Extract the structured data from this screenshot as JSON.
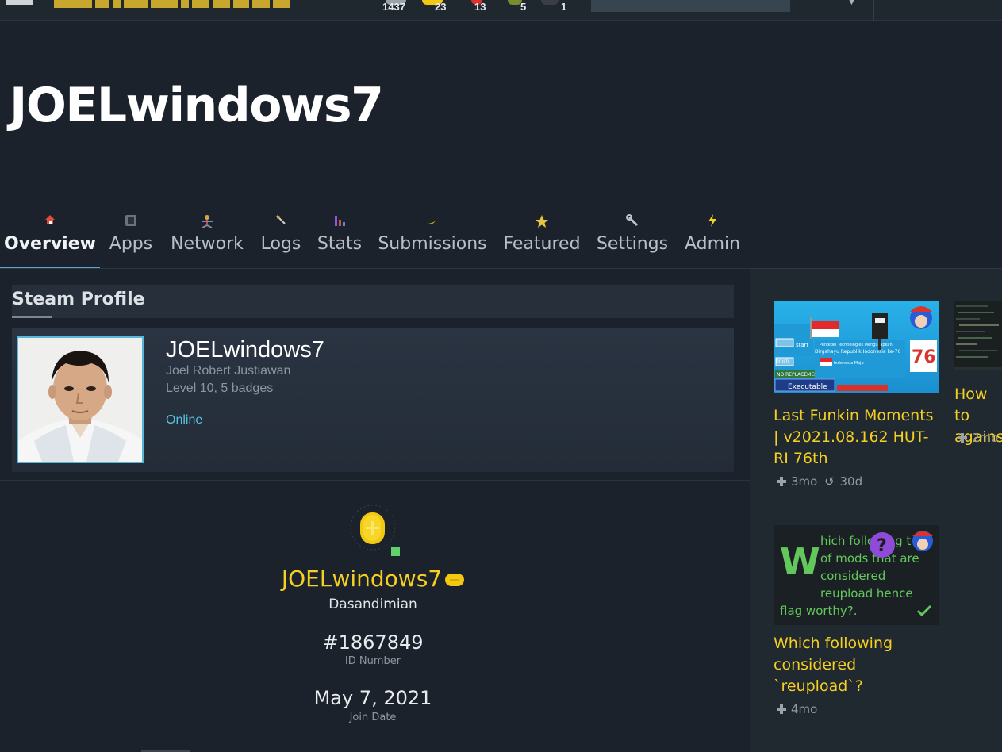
{
  "topbar": {
    "stats": [
      {
        "value": "1437",
        "icon": "level-icon"
      },
      {
        "value": "23",
        "icon": "coin-icon"
      },
      {
        "value": "13",
        "icon": "heart-icon"
      },
      {
        "value": "5",
        "icon": "leaf-icon"
      },
      {
        "value": "1",
        "icon": "bomb-icon"
      }
    ]
  },
  "header": {
    "title": "JOELwindows7"
  },
  "tabs": [
    {
      "label": "Overview",
      "icon": "house-icon",
      "active": true
    },
    {
      "label": "Apps",
      "icon": "apps-icon"
    },
    {
      "label": "Network",
      "icon": "network-icon"
    },
    {
      "label": "Logs",
      "icon": "logs-icon"
    },
    {
      "label": "Stats",
      "icon": "stats-icon"
    },
    {
      "label": "Submissions",
      "icon": "submissions-icon"
    },
    {
      "label": "Featured",
      "icon": "star-icon"
    },
    {
      "label": "Settings",
      "icon": "wrench-icon"
    },
    {
      "label": "Admin",
      "icon": "lightning-icon"
    }
  ],
  "steam": {
    "heading": "Steam Profile",
    "name": "JOELwindows7",
    "real_name": "Joel Robert Justiawan",
    "level": "Level 10, 5 badges",
    "status": "Online",
    "status_color": "#57c3e3"
  },
  "profile": {
    "name": "JOELwindows7",
    "subtitle": "Dasandimian",
    "id_number": "#1867849",
    "id_label": "ID Number",
    "join_date": "May 7, 2021",
    "join_label": "Join Date",
    "accent": "#f5d022"
  },
  "sidebar_cards": [
    {
      "title": "Last Funkin Moments | v2021.08.162 HUT-RI 76th",
      "age": "3mo",
      "updated": "30d",
      "thumb_text": {
        "start": "start",
        "finish": "finish",
        "no_replacement": "NO REPLACEMENT",
        "executable": "Executable",
        "greeting": "Perkedel Technologies Mengucapkan:",
        "headline": "Dirgahayu Republik Indonesia ke-76",
        "number": "76",
        "banner": "Indonesia Maju"
      }
    },
    {
      "title": "Which following considered `reupload`?",
      "age": "4mo",
      "thumb_text": {
        "big_letter": "W",
        "line1": "hich following t",
        "line2": "of mods that are",
        "line3": "considered",
        "line4": "reupload hence",
        "line5": "flag worthy?."
      }
    },
    {
      "title": "How to against",
      "age": "2mo"
    }
  ]
}
